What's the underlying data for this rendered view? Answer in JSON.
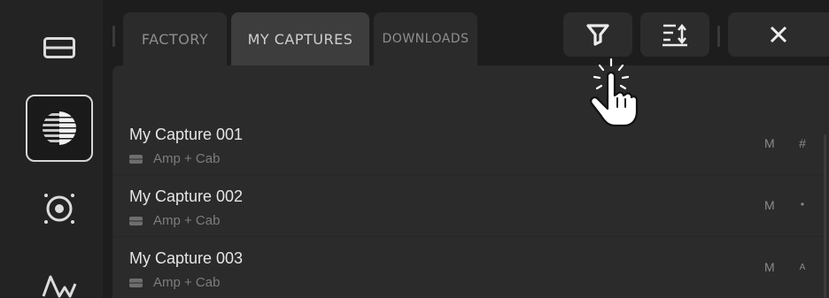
{
  "tabs": [
    {
      "label": "FACTORY"
    },
    {
      "label": "MY CAPTURES"
    },
    {
      "label": "DOWNLOADS"
    }
  ],
  "toolbar": {
    "filter_icon": "filter-icon",
    "sort_icon": "sort-icon",
    "close_icon": "close-icon"
  },
  "sidebar": {
    "items": [
      {
        "icon": "amp-cab-icon"
      },
      {
        "icon": "capture-striped-globe-icon",
        "selected": true
      },
      {
        "icon": "target-icon"
      },
      {
        "icon": "waveform-icon"
      }
    ]
  },
  "captures": [
    {
      "title": "My Capture 001",
      "type": "Amp + Cab",
      "col1": "M",
      "col2": "#"
    },
    {
      "title": "My Capture 002",
      "type": "Amp + Cab",
      "col1": "M",
      "col2": "•"
    },
    {
      "title": "My Capture 003",
      "type": "Amp + Cab",
      "col1": "M",
      "col2": "A"
    }
  ],
  "colors": {
    "background": "#1d1d1d",
    "panel": "#2b2b2b",
    "active_tab": "#3d3d3d",
    "text_primary": "#e6e6e6",
    "text_secondary": "#7d7d7d"
  },
  "overlay": {
    "icon": "tap-hand-icon"
  }
}
